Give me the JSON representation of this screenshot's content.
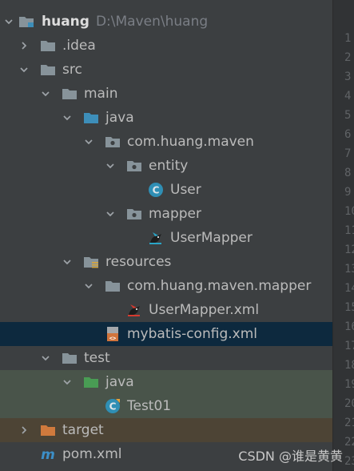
{
  "project": {
    "name": "huang",
    "path": "D:\\Maven\\huang"
  },
  "tree": {
    "idea": ".idea",
    "src": "src",
    "main": "main",
    "java": "java",
    "package": "com.huang.maven",
    "entity": "entity",
    "user": "User",
    "mapper": "mapper",
    "user_mapper": "UserMapper",
    "resources": "resources",
    "resources_package": "com.huang.maven.mapper",
    "user_mapper_xml": "UserMapper.xml",
    "mybatis_config": "mybatis-config.xml",
    "test": "test",
    "test_java": "java",
    "test01": "Test01",
    "target": "target",
    "pom": "pom.xml"
  },
  "gutter": {
    "line_numbers": [
      "1",
      "2",
      "3",
      "4",
      "5",
      "6",
      "7",
      "8",
      "9",
      "10",
      "11",
      "12",
      "13",
      "14",
      "15",
      "16",
      "17",
      "18",
      "19",
      "20",
      "21",
      "22",
      "23"
    ]
  },
  "watermark": "CSDN @谁是黄黄",
  "colors": {
    "folder": "#87939a",
    "source_folder": "#3d8eb9",
    "test_folder": "#499c54",
    "excluded_folder": "#d07a3d",
    "class_icon": "#2f8fb5",
    "selection": "#0d293e"
  }
}
